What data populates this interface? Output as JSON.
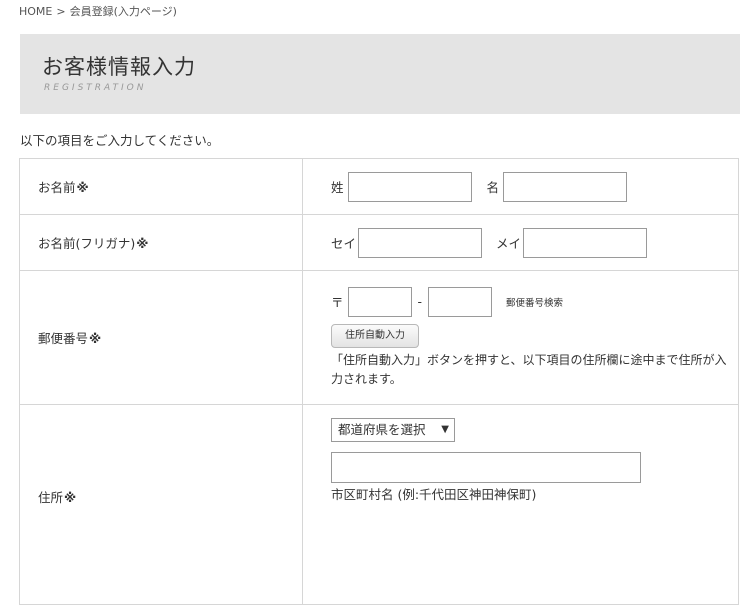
{
  "breadcrumb": {
    "home": "HOME",
    "separator": ">",
    "current": "会員登録(入力ページ)"
  },
  "hero": {
    "title": "お客様情報入力",
    "subtitle": "REGISTRATION"
  },
  "intro": "以下の項目をご入力してください。",
  "required_mark": "※",
  "rows": {
    "name": {
      "label": "お名前",
      "last_label": "姓",
      "first_label": "名",
      "last_value": "",
      "first_value": ""
    },
    "kana": {
      "label": "お名前(フリガナ)",
      "last_label": "セイ",
      "first_label": "メイ",
      "last_value": "",
      "first_value": ""
    },
    "postal": {
      "label": "郵便番号",
      "prefix": "〒",
      "dash": "-",
      "search_link": "郵便番号検索",
      "auto_button": "住所自動入力",
      "note": "「住所自動入力」ボタンを押すと、以下項目の住所欄に途中まで住所が入力されます。"
    },
    "address": {
      "label": "住所",
      "prefecture_select": "都道府県を選択",
      "city_value": "",
      "city_caption": "市区町村名 (例:千代田区神田神保町)"
    }
  }
}
